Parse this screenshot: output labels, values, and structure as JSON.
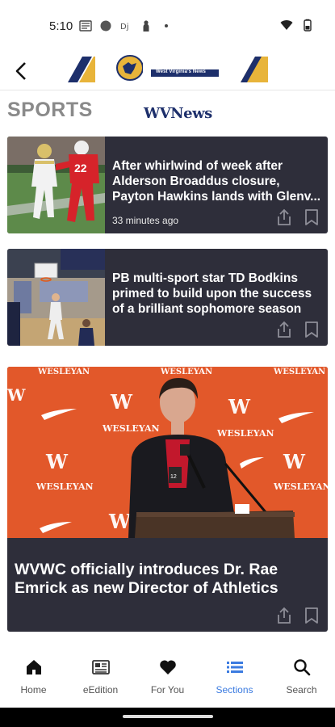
{
  "status_bar": {
    "time": "5:10",
    "icons_left": [
      "news-icon",
      "circle-icon",
      "dj-icon",
      "person-icon",
      "dot-icon"
    ],
    "icons_right": [
      "wifi-icon",
      "battery-icon"
    ]
  },
  "header": {
    "back_icon": "back-arrow-icon",
    "logo_text": "WVNews",
    "logo_subtext": "West Virginia's News"
  },
  "section": {
    "title": "SPORTS"
  },
  "articles": [
    {
      "title": "After whirlwind of week after Alderson Broaddus closure, Payton Hawkins lands with Glenv…",
      "title_lines": [
        "After whirlwind of week after",
        "Alderson Broaddus closure,",
        "Payton Hawkins lands with Glenv..."
      ],
      "time": "33 minutes ago",
      "thumb": "football-photo"
    },
    {
      "title": "PB multi-sport star TD Bodkins primed to build upon the success of a brilliant sophomore season",
      "title_lines": [
        "PB multi-sport star TD Bodkins",
        "primed to build upon the success",
        "of a brilliant sophomore season"
      ],
      "time": "",
      "thumb": "basketball-photo"
    },
    {
      "title": "WVWC officially introduces Dr. Rae Emrick as new Director of Athletics",
      "title_lines": [
        "WVWC officially introduces Dr. Rae",
        "Emrick as new Director of Athletics"
      ],
      "thumb": "press-conference-photo",
      "backdrop_text": "WESLEYAN"
    }
  ],
  "actions": {
    "share": "share-icon",
    "bookmark": "bookmark-icon"
  },
  "bottom_nav": [
    {
      "label": "Home",
      "icon": "home-icon",
      "active": false
    },
    {
      "label": "eEdition",
      "icon": "newspaper-icon",
      "active": false
    },
    {
      "label": "For You",
      "icon": "heart-icon",
      "active": false
    },
    {
      "label": "Sections",
      "icon": "list-icon",
      "active": true
    },
    {
      "label": "Search",
      "icon": "search-icon",
      "active": false
    }
  ],
  "colors": {
    "card_bg": "#2e2e3a",
    "accent_blue": "#3b7be0",
    "brand_navy": "#1d2f6b",
    "brand_gold": "#e8b43a",
    "wesleyan_orange": "#e2582a"
  }
}
